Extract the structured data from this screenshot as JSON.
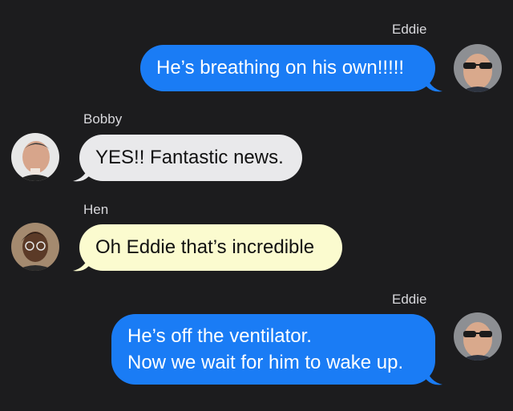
{
  "messages": [
    {
      "sender": "Eddie",
      "text_lines": [
        "He’s breathing on his own!!!!!"
      ],
      "direction": "outgoing",
      "avatar_icon": "eddie-avatar"
    },
    {
      "sender": "Bobby",
      "text_lines": [
        "YES!! Fantastic news."
      ],
      "direction": "incoming",
      "avatar_icon": "bobby-avatar"
    },
    {
      "sender": "Hen",
      "text_lines": [
        "Oh Eddie that’s incredible"
      ],
      "direction": "incoming",
      "avatar_icon": "hen-avatar"
    },
    {
      "sender": "Eddie",
      "text_lines": [
        "He’s off the ventilator.",
        "Now we wait for him to wake up."
      ],
      "direction": "outgoing",
      "avatar_icon": "eddie-avatar"
    }
  ],
  "colors": {
    "background": "#1c1c1e",
    "outgoing_bubble": "#1a7cf5",
    "bobby_bubble": "#e9e9eb",
    "hen_bubble": "#fbfbcf"
  }
}
